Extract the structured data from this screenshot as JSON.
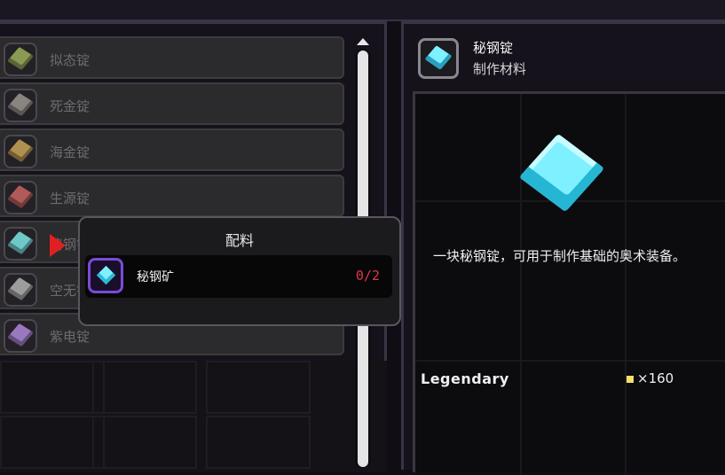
{
  "materials": [
    {
      "label": "拟态锭",
      "color": "#8a9a52",
      "icon": "ingot-icon"
    },
    {
      "label": "死金锭",
      "color": "#8a8480",
      "icon": "ingot-icon"
    },
    {
      "label": "海金锭",
      "color": "#b09050",
      "icon": "ingot-icon"
    },
    {
      "label": "生源锭",
      "color": "#b05a5a",
      "icon": "ingot-icon"
    },
    {
      "label": "秘钢锭",
      "color": "#6fc8c8",
      "icon": "ingot-icon"
    },
    {
      "label": "空无锭",
      "color": "#9c9c9c",
      "icon": "ingot-icon"
    },
    {
      "label": "紫电锭",
      "color": "#9a78c0",
      "icon": "ingot-icon"
    }
  ],
  "popup": {
    "title": "配料",
    "ingredient": {
      "name": "秘钢矿",
      "count": "0/2",
      "icon": "ore-gem-icon"
    }
  },
  "detail": {
    "name": "秘钢锭",
    "type": "制作材料",
    "description": "一块秘钢锭，可用于制作基础的奥术装备。",
    "rarity": "Legendary",
    "price": "×160",
    "icon": "arcanite-ingot-icon"
  },
  "colors": {
    "accent": "#7ff0ff",
    "count_red": "#e0364b",
    "rarity_gold": "#f4e06a"
  }
}
